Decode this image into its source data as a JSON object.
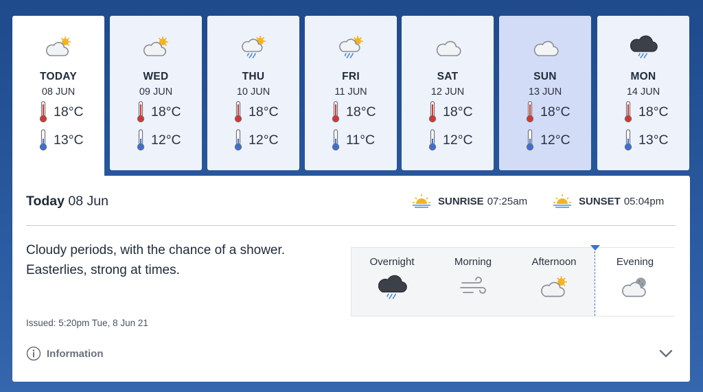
{
  "days": [
    {
      "name": "TODAY",
      "date": "08 JUN",
      "max": "18°C",
      "min": "13°C",
      "icon": "sun-cloud-icon"
    },
    {
      "name": "WED",
      "date": "09 JUN",
      "max": "18°C",
      "min": "12°C",
      "icon": "sun-cloud-icon"
    },
    {
      "name": "THU",
      "date": "10 JUN",
      "max": "18°C",
      "min": "12°C",
      "icon": "sun-shower-icon"
    },
    {
      "name": "FRI",
      "date": "11 JUN",
      "max": "18°C",
      "min": "11°C",
      "icon": "sun-shower-icon"
    },
    {
      "name": "SAT",
      "date": "12 JUN",
      "max": "18°C",
      "min": "12°C",
      "icon": "cloud-icon"
    },
    {
      "name": "SUN",
      "date": "13 JUN",
      "max": "18°C",
      "min": "12°C",
      "icon": "cloud-icon"
    },
    {
      "name": "MON",
      "date": "14 JUN",
      "max": "18°C",
      "min": "13°C",
      "icon": "dark-cloud-rain-icon"
    }
  ],
  "panel": {
    "title_bold": "Today",
    "title_date": "08 Jun",
    "sunrise_label": "SUNRISE",
    "sunrise_time": "07:25am",
    "sunset_label": "SUNSET",
    "sunset_time": "05:04pm",
    "description_line1": "Cloudy periods, with the chance of a shower.",
    "description_line2": "Easterlies, strong at times.",
    "issued": "Issued: 5:20pm Tue, 8 Jun 21",
    "info_label": "Information"
  },
  "periods": [
    {
      "label": "Overnight",
      "icon": "dark-cloud-rain-icon"
    },
    {
      "label": "Morning",
      "icon": "wind-icon"
    },
    {
      "label": "Afternoon",
      "icon": "sun-cloud-icon"
    },
    {
      "label": "Evening",
      "icon": "moon-cloud-icon"
    }
  ],
  "colors": {
    "background": "#2a5aa0",
    "selected_day": "#d3dcf6",
    "day_card": "#eef2fb",
    "sun_yellow": "#f5b41e",
    "thermo_red": "#d9342b",
    "thermo_blue": "#3a6fd8"
  }
}
